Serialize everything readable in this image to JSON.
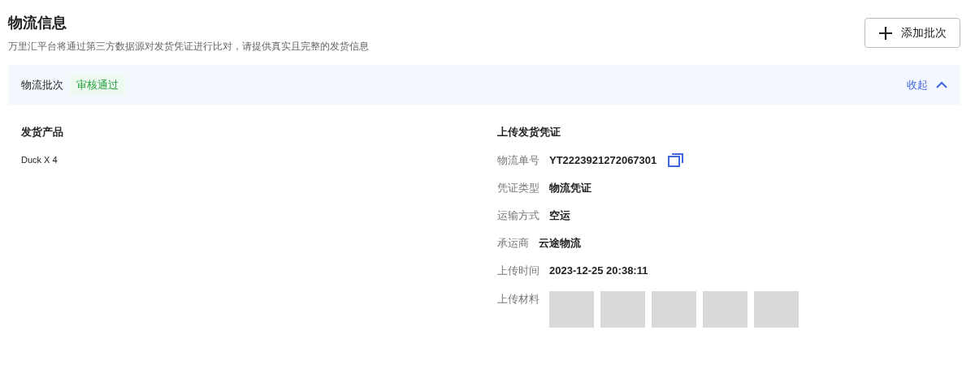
{
  "header": {
    "title": "物流信息",
    "subtitle": "万里汇平台将通过第三方数据源对发货凭证进行比对，请提供真实且完整的发货信息",
    "add_button": "添加批次"
  },
  "batch": {
    "title": "物流批次",
    "status": "审核通过",
    "toggle": "收起",
    "expanded": true,
    "products": {
      "title": "发货产品",
      "items": [
        "Duck X 4"
      ]
    },
    "proof": {
      "title": "上传发货凭证",
      "fields": [
        {
          "kind": "text",
          "label": "物流单号",
          "value": "YT2223921272067301",
          "copyable": true
        },
        {
          "kind": "text",
          "label": "凭证类型",
          "value": "物流凭证",
          "copyable": false
        },
        {
          "kind": "text",
          "label": "运输方式",
          "value": "空运",
          "copyable": false
        },
        {
          "kind": "text",
          "label": "承运商",
          "value": "云途物流",
          "copyable": false
        },
        {
          "kind": "text",
          "label": "上传时间",
          "value": "2023-12-25 20:38:11",
          "copyable": false
        },
        {
          "kind": "images",
          "label": "上传材料"
        }
      ]
    }
  }
}
